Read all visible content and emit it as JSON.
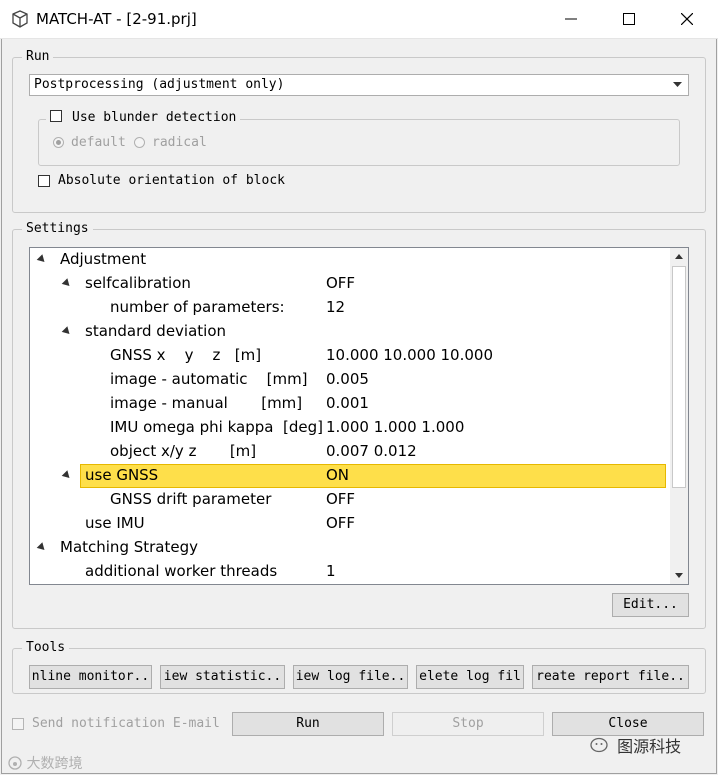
{
  "window": {
    "title": "MATCH-AT - [2-91.prj]"
  },
  "run_group": {
    "title": "Run",
    "mode_value": "Postprocessing (adjustment only)",
    "blunder": {
      "label": "Use blunder detection",
      "checked": false
    },
    "radio_default": "default",
    "radio_radical": "radical",
    "absolute_orientation": {
      "label": "Absolute orientation of block",
      "checked": false
    }
  },
  "settings_group": {
    "title": "Settings",
    "rows": [
      {
        "label": "Adjustment",
        "value": "",
        "level": 0,
        "expander": true
      },
      {
        "label": "selfcalibration",
        "value": "OFF",
        "level": 1,
        "expander": true
      },
      {
        "label": "number of parameters:",
        "value": "12",
        "level": 2,
        "expander": false
      },
      {
        "label": "standard deviation",
        "value": "",
        "level": 1,
        "expander": true
      },
      {
        "label": "GNSS x    y    z   [m]",
        "value": "10.000 10.000 10.000",
        "level": 2,
        "expander": false
      },
      {
        "label": "image - automatic    [mm]",
        "value": "0.005",
        "level": 2,
        "expander": false
      },
      {
        "label": "image - manual       [mm]",
        "value": "0.001",
        "level": 2,
        "expander": false
      },
      {
        "label": "IMU omega phi kappa  [deg]",
        "value": "1.000 1.000 1.000",
        "level": 2,
        "expander": false
      },
      {
        "label": "object x/y z       [m]",
        "value": "0.007 0.012",
        "level": 2,
        "expander": false
      },
      {
        "label": "use GNSS",
        "value": "ON",
        "level": 1,
        "expander": true,
        "selected": true
      },
      {
        "label": "GNSS drift parameter",
        "value": "OFF",
        "level": 2,
        "expander": false
      },
      {
        "label": "use IMU",
        "value": "OFF",
        "level": 1,
        "expander": false
      },
      {
        "label": "Matching Strategy",
        "value": "",
        "level": 0,
        "expander": true
      },
      {
        "label": "additional worker threads",
        "value": "1",
        "level": 1,
        "expander": false
      }
    ],
    "edit_button": "Edit..."
  },
  "tools_group": {
    "title": "Tools",
    "buttons": [
      "nline monitor..",
      "iew statistic..",
      "iew log file..",
      "elete log fil",
      "reate report file.."
    ]
  },
  "bottom": {
    "notify_label": "Send notification E-mail",
    "run_button": "Run",
    "stop_button": "Stop",
    "close_button": "Close"
  },
  "watermarks": {
    "left": "大数跨境",
    "right": "图源科技"
  },
  "colors": {
    "selection": "#fedf4a",
    "window_bg": "#f0f0f0"
  }
}
